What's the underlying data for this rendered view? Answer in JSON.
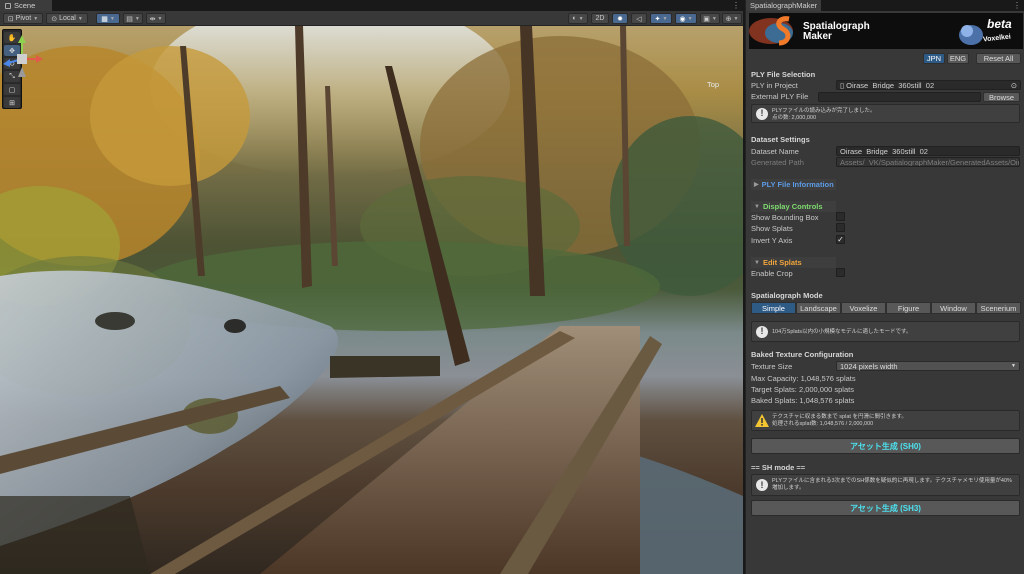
{
  "scene": {
    "tab_label": "Scene",
    "toolbar": {
      "pivot": "Pivot",
      "local": "Local",
      "mode_2d": "2D"
    },
    "gizmo_label": "Top"
  },
  "panel": {
    "tab_label": "SpatialographMaker",
    "banner": {
      "title": "Spatialograph\nMaker",
      "beta": "beta",
      "sub": "Voxelkei"
    },
    "lang": {
      "jpn": "JPN",
      "eng": "ENG",
      "reset": "Reset All"
    },
    "ply_selection": {
      "header": "PLY File Selection",
      "ply_in_project_label": "PLY in Project",
      "ply_in_project_value": "Oirase_Bridge_360still_02",
      "external_label": "External PLY File",
      "external_value": "",
      "browse": "Browse",
      "help_line1": "PLYファイルの読み込みが完了しました。",
      "help_line2": "点の数: 2,000,000"
    },
    "dataset": {
      "header": "Dataset Settings",
      "name_label": "Dataset Name",
      "name_value": "Oirase_Bridge_360still_02",
      "path_label": "Generated Path",
      "path_value": "Assets/_VK/SpatialographMaker/GeneratedAssets/Oirase"
    },
    "ply_info": {
      "label": "PLY File Information"
    },
    "display": {
      "label": "Display Controls",
      "show_bbox": "Show Bounding Box",
      "show_splats": "Show Splats",
      "invert_y": "Invert Y Axis",
      "check_mark": "✓"
    },
    "edit": {
      "label": "Edit Splats",
      "enable_crop": "Enable Crop"
    },
    "mode": {
      "header": "Spatialograph Mode",
      "options": [
        "Simple",
        "Landscape",
        "Voxelize",
        "Figure",
        "Window",
        "Scenerium"
      ],
      "selected": "Simple",
      "help": "104万Splats以内の小規模なモデルに適したモードです。"
    },
    "baked": {
      "header": "Baked Texture Configuration",
      "texture_size_label": "Texture Size",
      "texture_size_value": "1024 pixels width",
      "max_capacity": "Max Capacity: 1,048,576 splats",
      "target_splats": "Target Splats: 2,000,000 splats",
      "baked_splats": "Baked Splats: 1,048,576 splats",
      "warn_line1": "テクスチャに収まる数まで splat を円滑に間引きます。",
      "warn_line2": "処理されるsplat数: 1,048,576 / 2,000,000"
    },
    "gen_sh0": "アセット生成 (SH0)",
    "sh_mode": {
      "header": "== SH mode ==",
      "help": "PLYファイルに含まれる3次までのSH係数を疑似的に再現します。テクスチャメモリ使用量が40%増加します。"
    },
    "gen_sh3": "アセット生成 (SH3)",
    "colors": {
      "accent_blue": "#2e5a86",
      "fold_blue": "#5c9be6",
      "fold_green": "#7fdc6f",
      "fold_orange": "#f0a53c",
      "button_cyan": "#4ce3f0"
    }
  }
}
